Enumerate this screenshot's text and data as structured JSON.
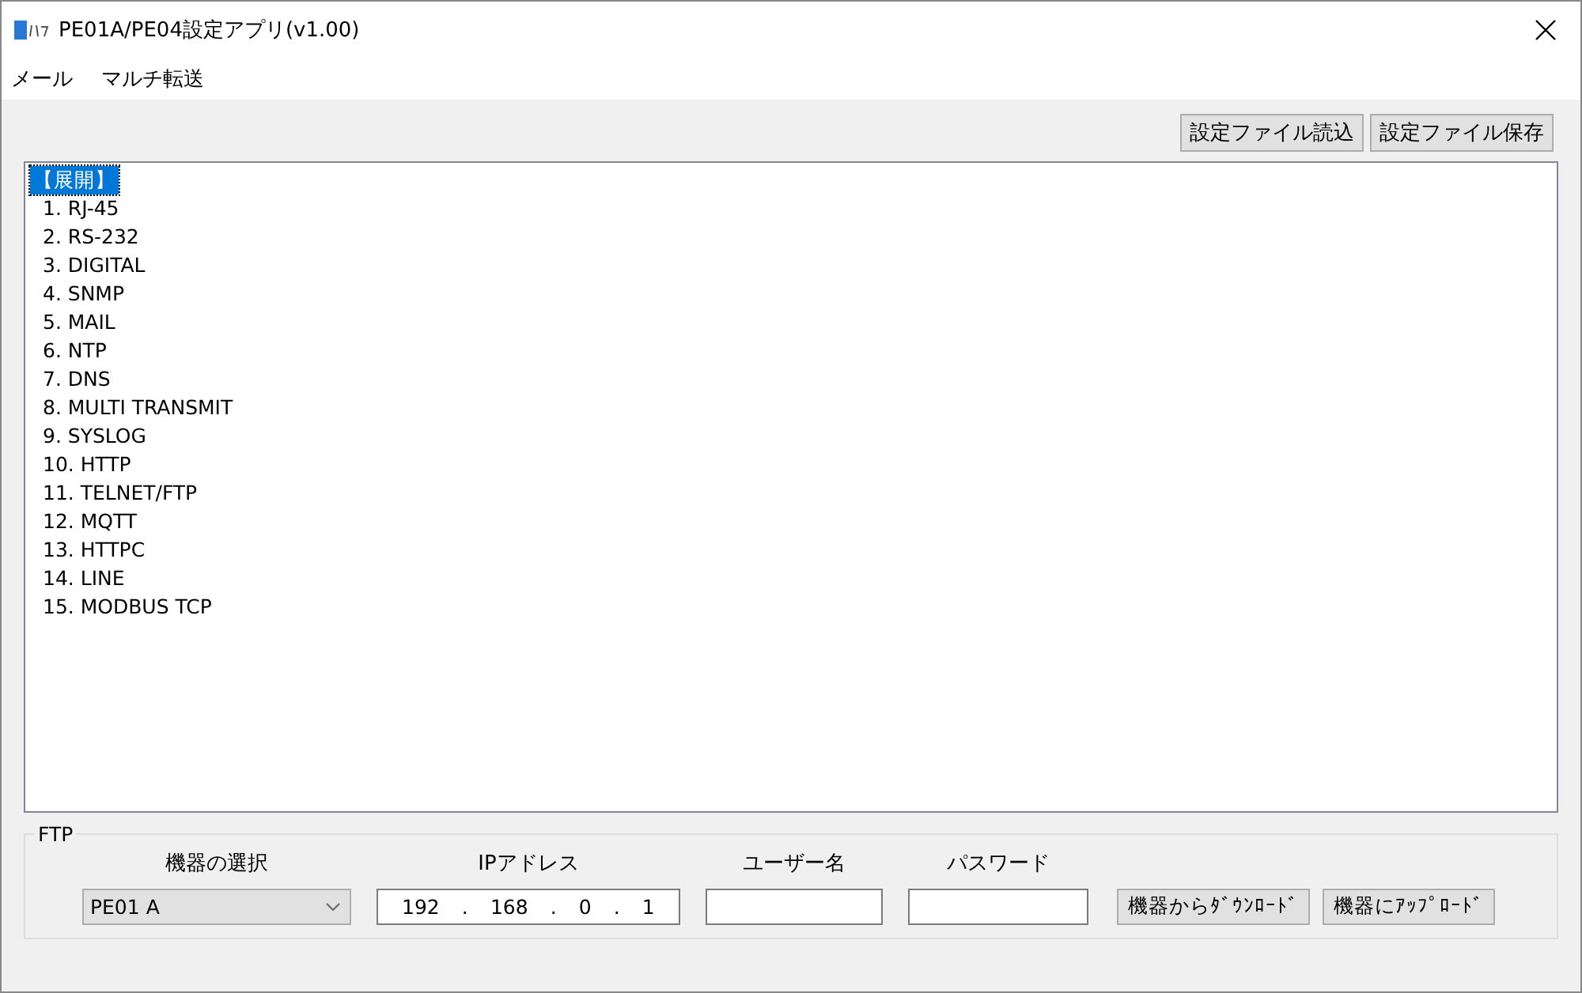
{
  "window": {
    "title": "PE01A/PE04設定アプリ(v1.00)"
  },
  "menu": [
    "メール",
    "マルチ転送"
  ],
  "toolbar_buttons": [
    "設定ファイル読込",
    "設定ファイル保存"
  ],
  "tree": {
    "label": "【展開】",
    "selected": true,
    "children": [
      {
        "label": "1. RJ-45",
        "selected": false
      },
      {
        "label": "2. RS-232",
        "selected": false
      },
      {
        "label": "3. DIGITAL",
        "selected": false
      },
      {
        "label": "4. SNMP",
        "selected": false
      },
      {
        "label": "5. MAIL",
        "selected": false
      },
      {
        "label": "6. NTP",
        "selected": false
      },
      {
        "label": "7. DNS",
        "selected": false
      },
      {
        "label": "8. MULTI TRANSMIT",
        "selected": false
      },
      {
        "label": "9. SYSLOG",
        "selected": false
      },
      {
        "label": "10. HTTP",
        "selected": false
      },
      {
        "label": "11. TELNET/FTP",
        "selected": false
      },
      {
        "label": "12. MQTT",
        "selected": false
      },
      {
        "label": "13. HTTPC",
        "selected": false
      },
      {
        "label": "14. LINE",
        "selected": false
      },
      {
        "label": "15. MODBUS TCP",
        "selected": false
      }
    ]
  },
  "ftp": {
    "title": "FTP",
    "device": {
      "label": "機器の選択",
      "value": "PE01 A"
    },
    "ip": {
      "label": "IPアドレス",
      "octets": [
        "192",
        "168",
        "0",
        "1"
      ],
      "separator": "."
    },
    "user": {
      "label": "ユーザー名"
    },
    "password": {
      "label": "パスワード"
    },
    "buttons": [
      "機器からﾀﾞｳﾝﾛｰﾄﾞ",
      "機器にｱｯﾌﾟﾛｰﾄﾞ"
    ]
  }
}
